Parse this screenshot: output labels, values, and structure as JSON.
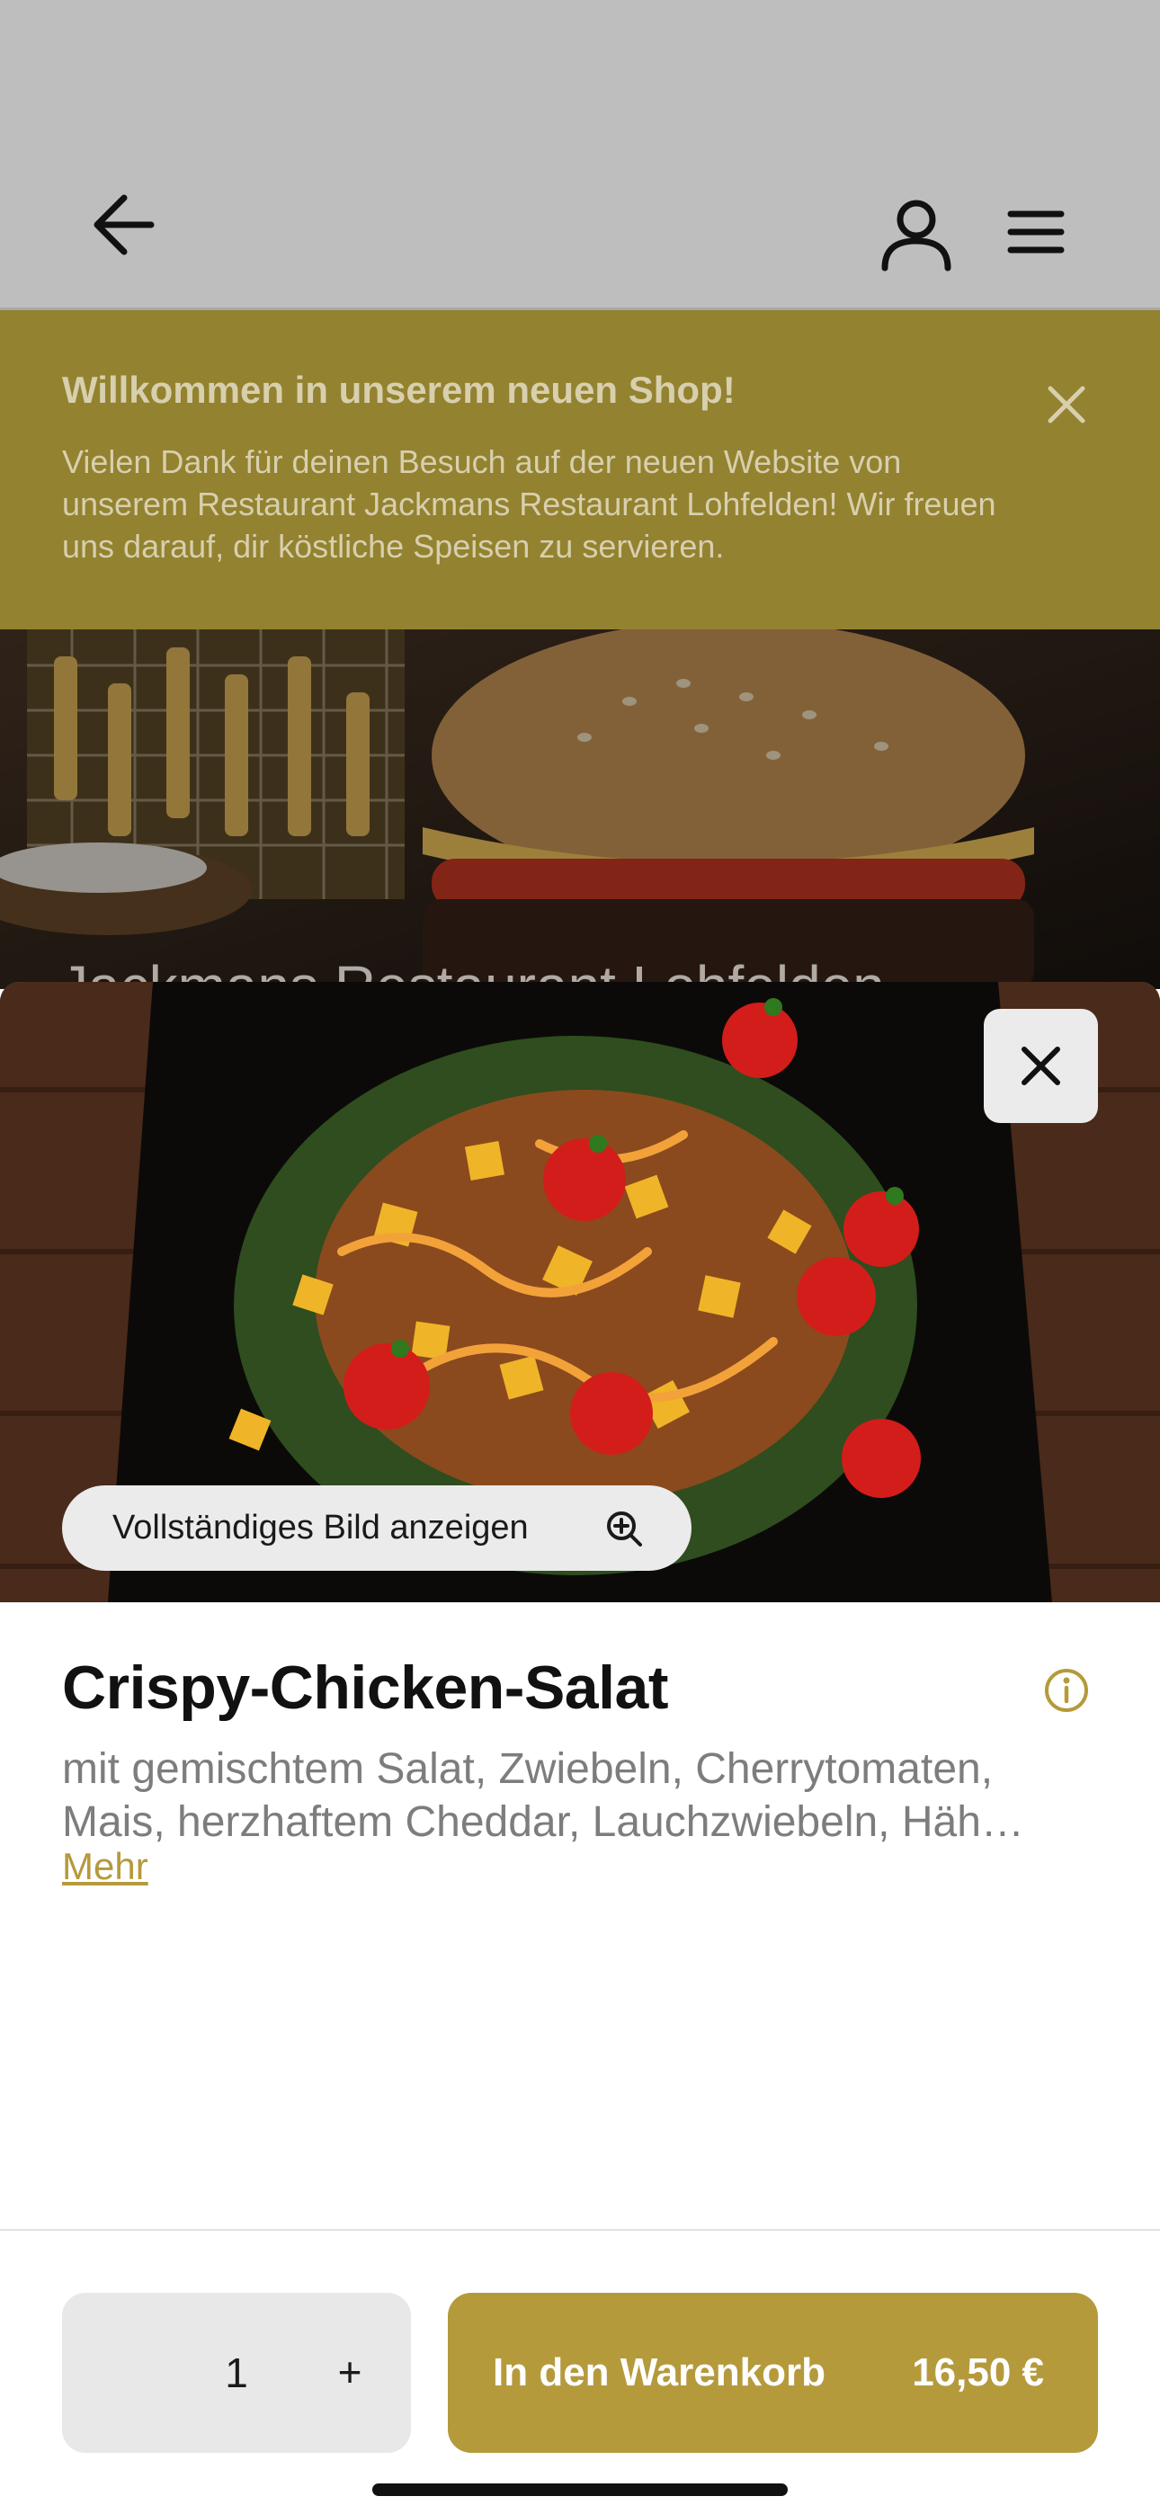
{
  "header": {
    "back_icon": "arrow-left-icon",
    "account_icon": "user-icon",
    "menu_icon": "hamburger-menu-icon"
  },
  "banner": {
    "title": "Willkommen in unserem neuen Shop!",
    "text": "Vielen Dank für deinen Besuch auf der neuen Website von unserem Restaurant Jackmans Restaurant Lohfelden! Wir freuen uns darauf, dir köstliche Speisen zu servieren.",
    "close_icon": "close-icon"
  },
  "hero": {
    "restaurant_name": "Jackmans Restaurant Lohfelden"
  },
  "product": {
    "full_image_label": "Vollständiges Bild anzeigen",
    "full_image_icon": "zoom-in-icon",
    "close_icon": "close-icon",
    "title": "Crispy-Chicken-Salat",
    "info_icon": "info-icon",
    "description_line1": "mit gemischtem Salat, Zwiebeln, Cherrytomaten,",
    "description_line2": "Mais, herzhaftem Cheddar, Lauchzwiebeln, Häh…",
    "more_label": "Mehr"
  },
  "cart": {
    "quantity": "1",
    "plus_label": "+",
    "add_label": "In den Warenkorb",
    "price": "16,50 €"
  },
  "colors": {
    "accent": "#b59a3c",
    "banner_bg": "#93822f",
    "overlay_bar": "#bebebe"
  }
}
